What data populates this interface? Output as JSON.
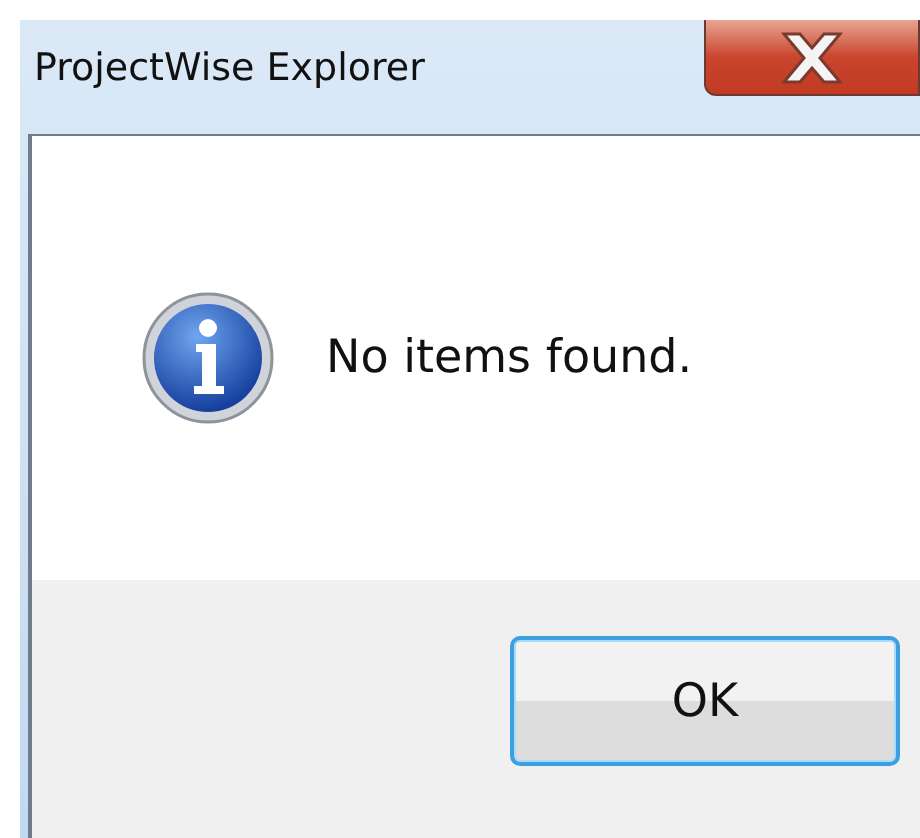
{
  "window": {
    "title": "ProjectWise Explorer"
  },
  "message": {
    "text": "No items found."
  },
  "buttons": [
    {
      "label": "OK",
      "default": true
    }
  ]
}
